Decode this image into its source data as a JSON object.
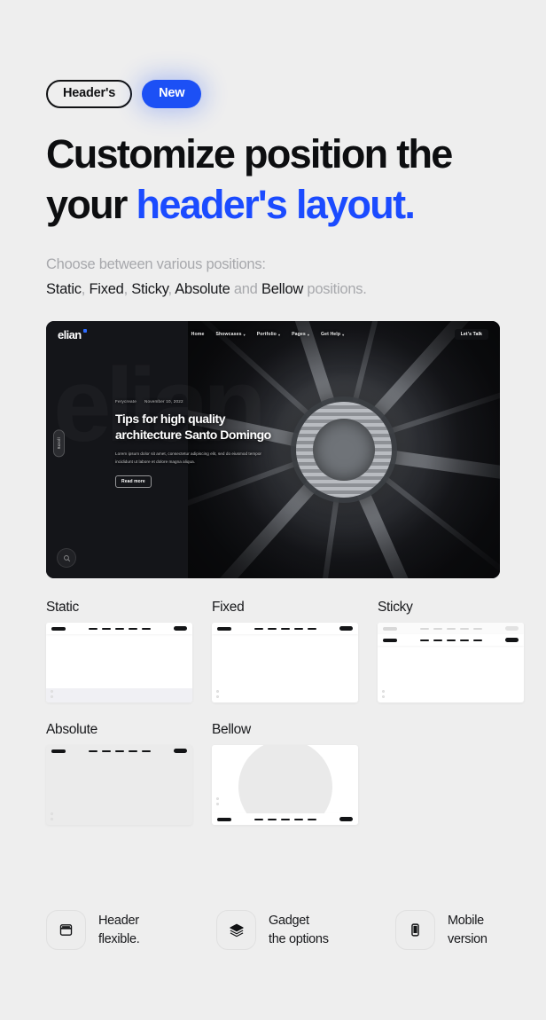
{
  "theme": {
    "background": "#eeeeee",
    "accent_blue": "#1B4BFF",
    "pill_blue": "#1C50F5",
    "text_dark": "#0D0E10",
    "text_muted": "#A7A8AC"
  },
  "badges": {
    "tag_label": "Header's",
    "new_label": "New"
  },
  "headline": {
    "line1": "Customize position",
    "line2_dark": "the your ",
    "line2_accent": "header's",
    "line3_accent": "layout."
  },
  "subtitle": {
    "lead": "Choose between various positions:",
    "item1": "Static",
    "sep1": ", ",
    "item2": "Fixed",
    "sep2": ", ",
    "item3": "Sticky",
    "sep3": ", ",
    "item4": "Absolute",
    "conj": " and ",
    "item5": "Bellow",
    "tail": " positions."
  },
  "hero": {
    "logo": "elian",
    "nav_items": [
      {
        "label": "Home",
        "has_caret": false
      },
      {
        "label": "Showcases",
        "has_caret": true
      },
      {
        "label": "Portfolio",
        "has_caret": true
      },
      {
        "label": "Pages",
        "has_caret": true
      },
      {
        "label": "Get Help",
        "has_caret": true
      }
    ],
    "cta_label": "Let's Talk",
    "meta_author": "Ferycreate",
    "meta_date": "November 10, 2022",
    "title": "Tips for high quality architecture Santo Domingo",
    "body": "Lorem ipsum dolor sit amet, consectetur adipiscing elit, sed do eiusmod tempor incididunt ut labore et dolore magna aliqua.",
    "read_more": "Read more",
    "side_pill": "Scroll",
    "watermark": "elian"
  },
  "position_cards": [
    {
      "label": "Static",
      "header_position": "top",
      "has_footer": true,
      "body_bg": "white",
      "blob": "gray"
    },
    {
      "label": "Fixed",
      "header_position": "top",
      "has_footer": false,
      "body_bg": "white",
      "blob": "gray"
    },
    {
      "label": "Sticky",
      "header_position": "double",
      "has_footer": false,
      "body_bg": "white",
      "blob": "gray"
    },
    {
      "label": "Absolute",
      "header_position": "overlay",
      "has_footer": false,
      "body_bg": "gray",
      "blob": "white"
    },
    {
      "label": "Bellow",
      "header_position": "bottom",
      "has_footer": false,
      "body_bg": "white",
      "blob": "gray"
    }
  ],
  "features": [
    {
      "icon": "header-layout-icon",
      "line1": "Header",
      "line2": "flexible."
    },
    {
      "icon": "layers-icon",
      "line1": "Gadget",
      "line2": "the options"
    },
    {
      "icon": "mobile-phone-icon",
      "line1": "Mobile",
      "line2": "version"
    }
  ]
}
